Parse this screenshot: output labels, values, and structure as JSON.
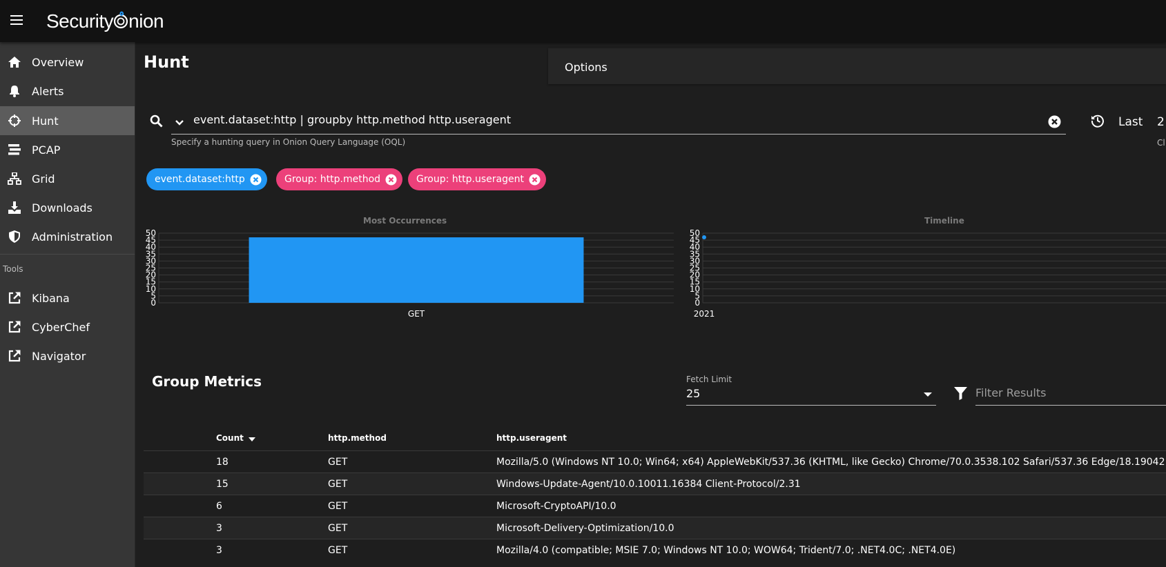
{
  "app": {
    "logo_text": "Security",
    "logo_suffix": "nion"
  },
  "sidebar": {
    "items": [
      {
        "label": "Overview",
        "icon": "home-icon"
      },
      {
        "label": "Alerts",
        "icon": "bell-icon"
      },
      {
        "label": "Hunt",
        "icon": "crosshairs-icon",
        "active": true
      },
      {
        "label": "PCAP",
        "icon": "stream-icon"
      },
      {
        "label": "Grid",
        "icon": "sitemap-icon"
      },
      {
        "label": "Downloads",
        "icon": "download-icon"
      },
      {
        "label": "Administration",
        "icon": "shield-icon"
      }
    ],
    "tools_header": "Tools",
    "tools": [
      {
        "label": "Kibana",
        "icon": "external-link-icon"
      },
      {
        "label": "CyberChef",
        "icon": "external-link-icon"
      },
      {
        "label": "Navigator",
        "icon": "external-link-icon"
      }
    ]
  },
  "main": {
    "title": "Hunt",
    "options_label": "Options",
    "query": {
      "value": "event.dataset:http | groupby http.method http.useragent",
      "hint": "Specify a hunting query in Onion Query Language (OQL)"
    },
    "date_range": {
      "label": "Last",
      "value": "2",
      "hint": "Cl"
    },
    "chips": [
      {
        "label": "event.dataset:http",
        "color": "#2196f3"
      },
      {
        "label": "Group: http.method",
        "color": "#ec407a"
      },
      {
        "label": "Group: http.useragent",
        "color": "#ec407a"
      }
    ]
  },
  "chart_data": [
    {
      "type": "bar",
      "title": "Most Occurrences",
      "categories": [
        "GET"
      ],
      "values": [
        47
      ],
      "ylim": [
        0,
        50
      ],
      "yticks": [
        0,
        5,
        10,
        15,
        20,
        25,
        30,
        35,
        40,
        45,
        50
      ],
      "color": "#2196f3"
    },
    {
      "type": "scatter",
      "title": "Timeline",
      "x": [
        "2021"
      ],
      "values": [
        47
      ],
      "ylim": [
        0,
        50
      ],
      "yticks": [
        0,
        5,
        10,
        15,
        20,
        25,
        30,
        35,
        40,
        45,
        50
      ],
      "color": "#2196f3"
    }
  ],
  "metrics": {
    "title": "Group Metrics",
    "fetch_limit_label": "Fetch Limit",
    "fetch_limit_value": "25",
    "filter_placeholder": "Filter Results",
    "columns": [
      "Count",
      "http.method",
      "http.useragent"
    ],
    "rows": [
      {
        "count": "18",
        "method": "GET",
        "useragent": "Mozilla/5.0 (Windows NT 10.0; Win64; x64) AppleWebKit/537.36 (KHTML, like Gecko) Chrome/70.0.3538.102 Safari/537.36 Edge/18.19042"
      },
      {
        "count": "15",
        "method": "GET",
        "useragent": "Windows-Update-Agent/10.0.10011.16384 Client-Protocol/2.31"
      },
      {
        "count": "6",
        "method": "GET",
        "useragent": "Microsoft-CryptoAPI/10.0"
      },
      {
        "count": "3",
        "method": "GET",
        "useragent": "Microsoft-Delivery-Optimization/10.0"
      },
      {
        "count": "3",
        "method": "GET",
        "useragent": "Mozilla/4.0 (compatible; MSIE 7.0; Windows NT 10.0; WOW64; Trident/7.0; .NET4.0C; .NET4.0E)"
      }
    ]
  }
}
